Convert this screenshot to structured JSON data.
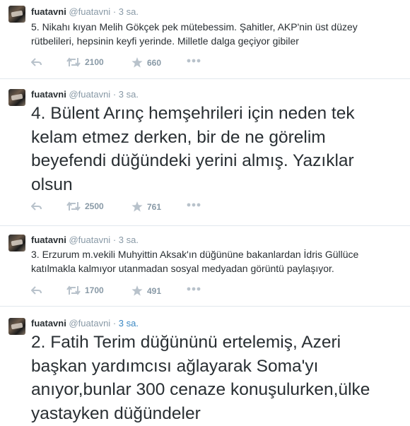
{
  "tweets": [
    {
      "name": "fuatavni",
      "handle": "@fuatavni",
      "dot": "·",
      "time": "3 sa.",
      "text_lines": [
        "5. Nikahı kıyan Melih Gökçek pek mütebessim. Şahitler, AKP'nin üst düzey",
        "rütbelileri, hepsinin keyfi yerinde. Milletle dalga geçiyor gibiler"
      ],
      "retweets": "2100",
      "favorites": "660"
    },
    {
      "name": "fuatavni",
      "handle": "@fuatavni",
      "dot": "·",
      "time": "3 sa.",
      "text_lines": [
        "4. Bülent Arınç hemşehrileri için neden tek",
        "kelam etmez derken, bir de ne görelim",
        "beyefendi düğündeki yerini almış. Yazıklar",
        "olsun"
      ],
      "retweets": "2500",
      "favorites": "761"
    },
    {
      "name": "fuatavni",
      "handle": "@fuatavni",
      "dot": "·",
      "time": "3 sa.",
      "text_lines": [
        "3. Erzurum m.vekili Muhyittin Aksak'ın düğününe bakanlardan İdris Güllüce",
        "katılmakla kalmıyor utanmadan sosyal medyadan görüntü paylaşıyor."
      ],
      "retweets": "1700",
      "favorites": "491"
    },
    {
      "name": "fuatavni",
      "handle": "@fuatavni",
      "dot": "·",
      "time": "3 sa.",
      "text_lines": [
        "2. Fatih Terim düğününü ertelemiş, Azeri",
        "başkan yardımcısı ağlayarak Soma'yı",
        "anıyor,bunlar 300 cenaze konuşulurken,ülke",
        "yastayken düğündeler"
      ]
    }
  ],
  "icons": {
    "reply": "reply-icon",
    "retweet": "retweet-icon",
    "favorite": "star-icon",
    "more": "more-icon"
  },
  "colors": {
    "text": "#292f33",
    "muted": "#8899a6",
    "link": "#3b88c3",
    "border": "#e1e8ed"
  }
}
